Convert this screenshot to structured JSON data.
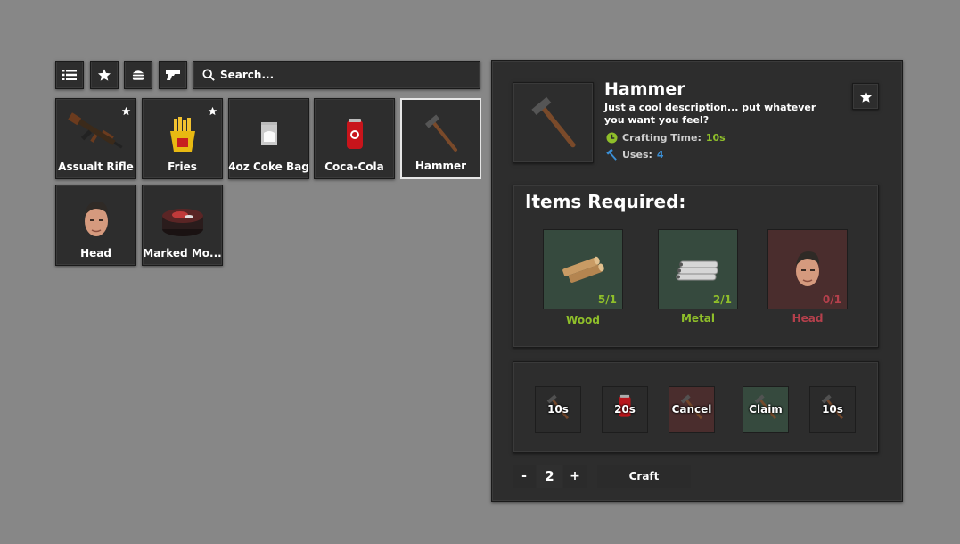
{
  "toolbar": {
    "icons": [
      "list-icon",
      "star-icon",
      "burger-icon",
      "gun-icon"
    ],
    "search_placeholder": "Search..."
  },
  "items": [
    {
      "name": "Assualt Rifle",
      "favorite": true
    },
    {
      "name": "Fries",
      "favorite": true
    },
    {
      "name": "4oz Coke Bag",
      "favorite": false
    },
    {
      "name": "Coca-Cola",
      "favorite": false
    },
    {
      "name": "Hammer",
      "favorite": false,
      "selected": true
    },
    {
      "name": "Head",
      "favorite": false
    },
    {
      "name": "Marked Mo...",
      "favorite": false
    }
  ],
  "detail": {
    "title": "Hammer",
    "description": "Just a cool description... put whatever you want you feel?",
    "crafting_label": "Crafting Time:",
    "crafting_value": "10s",
    "uses_label": "Uses:",
    "uses_value": "4"
  },
  "required": {
    "title": "Items Required:",
    "items": [
      {
        "name": "Wood",
        "count": "5/1",
        "status": "ok"
      },
      {
        "name": "Metal",
        "count": "2/1",
        "status": "ok"
      },
      {
        "name": "Head",
        "count": "0/1",
        "status": "missing"
      }
    ]
  },
  "queue": [
    {
      "label": "10s",
      "state": "default"
    },
    {
      "label": "20s",
      "state": "default"
    },
    {
      "label": "Cancel",
      "state": "cancel"
    },
    {
      "label": "Claim",
      "state": "claim"
    },
    {
      "label": "10s",
      "state": "default"
    }
  ],
  "craft": {
    "minus": "-",
    "quantity": "2",
    "plus": "+",
    "button": "Craft"
  },
  "colors": {
    "background": "#878787",
    "panel": "#2d2d2d",
    "ok_green": "#8fbf2a",
    "missing_red": "#b5404c",
    "uses_blue": "#3b8fd6",
    "ok_tile": "#364a3e",
    "missing_tile": "#4a2d2d"
  }
}
